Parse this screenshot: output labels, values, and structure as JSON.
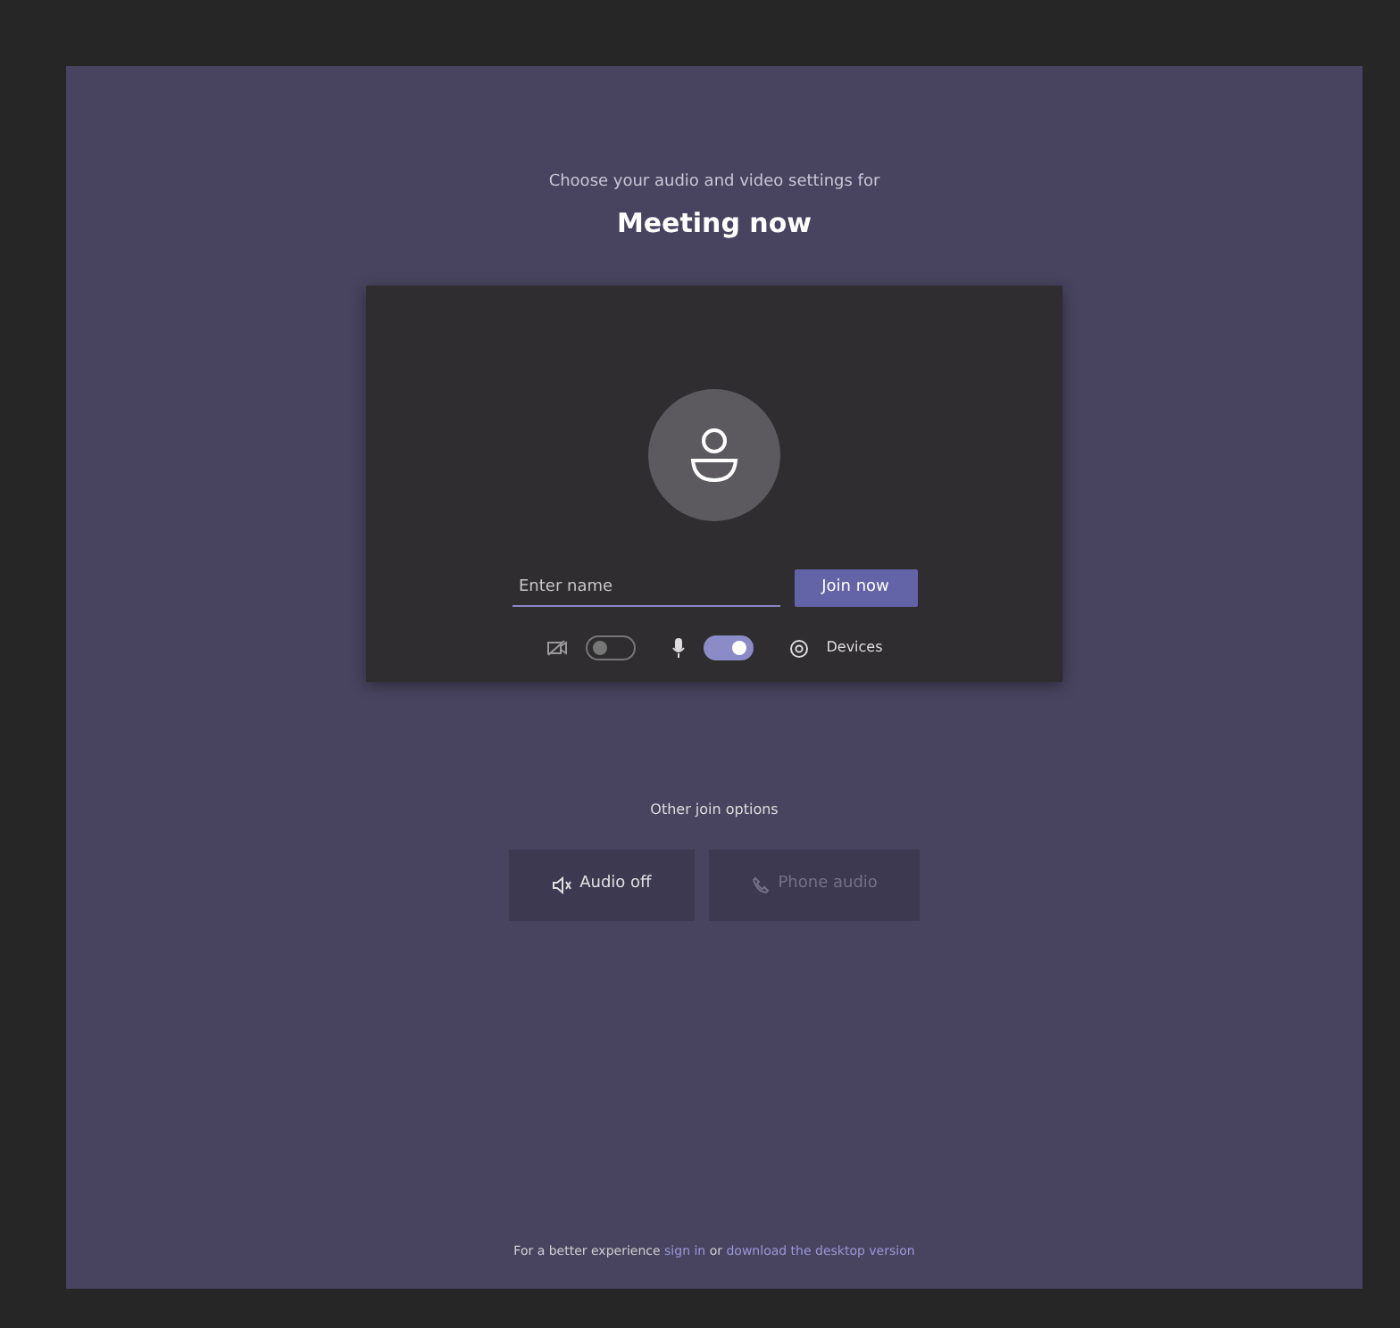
{
  "header": {
    "subtitle": "Choose your audio and video settings for",
    "title": "Meeting now"
  },
  "preview": {
    "name_field": {
      "placeholder": "Enter name"
    },
    "join_button": "Join now",
    "toggles": [
      {
        "kind": "camera",
        "on": false
      },
      {
        "kind": "microphone",
        "on": true
      }
    ],
    "devices_label": "Devices"
  },
  "other_options": {
    "heading": "Other join options",
    "options": [
      {
        "kind": "speaker",
        "label": "Audio off",
        "disabled": false
      },
      {
        "kind": "phone",
        "label": "Phone audio",
        "disabled": true
      }
    ]
  },
  "footer": {
    "text": "For a better experience",
    "link1": "sign in",
    "joiner": "or",
    "link2": "download the desktop version"
  }
}
